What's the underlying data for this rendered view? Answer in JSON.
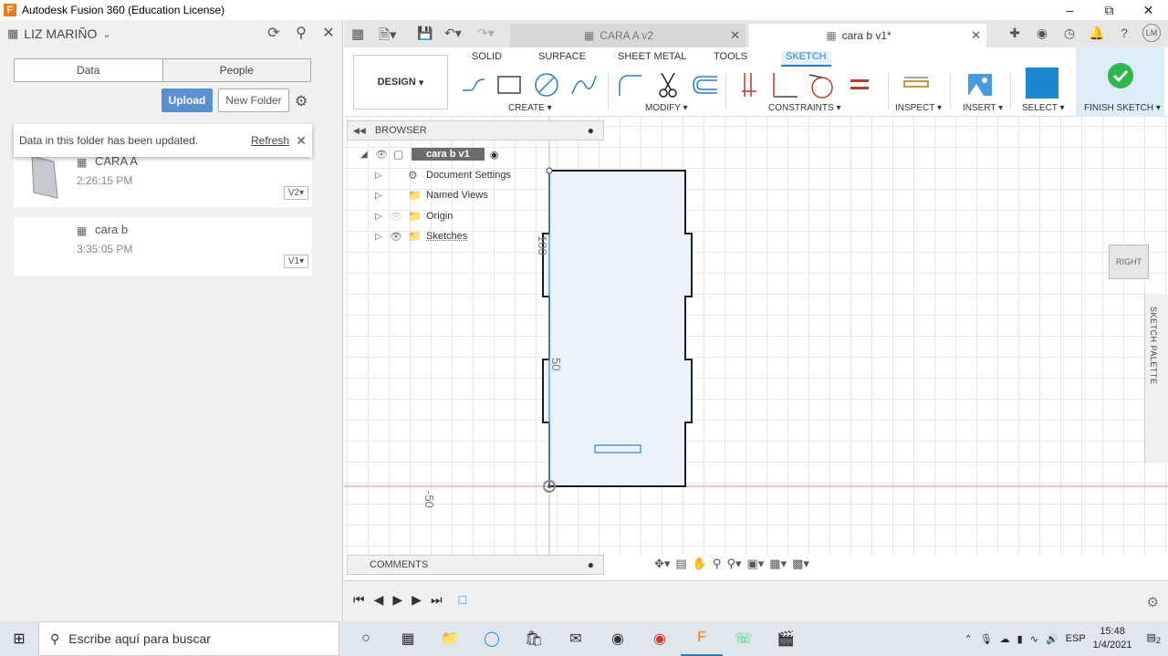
{
  "window": {
    "title": "Autodesk Fusion 360 (Education License)",
    "app_icon": "F",
    "minimize": "–",
    "restore": "⧉",
    "close": "✕"
  },
  "data_panel": {
    "user": "LIZ MARIÑO",
    "tabs": [
      "Data",
      "People"
    ],
    "upload_label": "Upload",
    "new_folder_label": "New Folder",
    "notification": {
      "message": "Data in this folder has been updated.",
      "action": "Refresh"
    },
    "files": [
      {
        "name": "CARA A",
        "time": "2:26:15 PM",
        "version": "V2▾"
      },
      {
        "name": "cara b",
        "time": "3:35:05 PM",
        "version": "V1▾"
      }
    ]
  },
  "document_tabs": [
    {
      "label": "CARA A v2",
      "active": false
    },
    {
      "label": "cara b v1*",
      "active": true
    }
  ],
  "user_initials": "LM",
  "toolbar": {
    "workspace": "DESIGN",
    "workspace_tabs": [
      "SOLID",
      "SURFACE",
      "SHEET METAL",
      "TOOLS",
      "SKETCH"
    ],
    "active_tab": "SKETCH",
    "groups": [
      "CREATE ▾",
      "MODIFY ▾",
      "CONSTRAINTS ▾",
      "INSPECT ▾",
      "INSERT ▾",
      "SELECT ▾",
      "FINISH SKETCH ▾"
    ]
  },
  "browser": {
    "title": "BROWSER",
    "root": "cara b v1",
    "items": [
      "Document Settings",
      "Named Views",
      "Origin",
      "Sketches"
    ]
  },
  "comments_title": "COMMENTS",
  "viewcube_label": "RIGHT",
  "sketch_palette_label": "SKETCH PALETTE",
  "dimensions": {
    "label_100": "100",
    "label_50": "50",
    "label_minus50": "-50"
  },
  "taskbar": {
    "search_placeholder": "Escribe aquí para buscar",
    "language": "ESP",
    "time": "15:48",
    "date": "1/4/2021",
    "notifications": "2"
  },
  "colors": {
    "accent": "#2b7dc7",
    "upload": "#5a8fd0",
    "finish_green": "#2db84d",
    "sketch_fill": "#eaf3fb"
  }
}
